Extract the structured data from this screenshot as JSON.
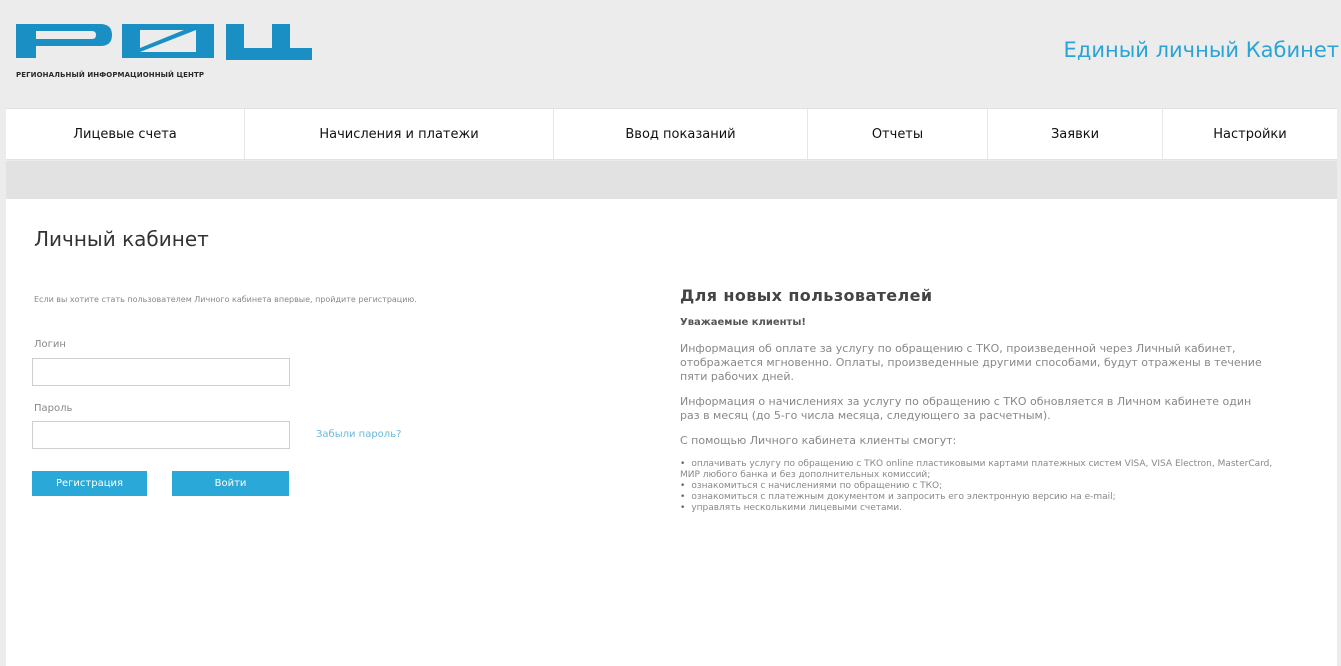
{
  "header": {
    "logo_text": "РЕГИОНАЛЬНЫЙ ИНФОРМАЦИОННЫЙ ЦЕНТР",
    "site_title": "Единый личный Кабинет",
    "brand_color": "#1a8fc4"
  },
  "nav": [
    {
      "label": "Лицевые счета"
    },
    {
      "label": "Начисления и платежи"
    },
    {
      "label": "Ввод показаний"
    },
    {
      "label": "Отчеты"
    },
    {
      "label": "Заявки"
    },
    {
      "label": "Настройки"
    }
  ],
  "login": {
    "title": "Личный кабинет",
    "registration_hint": "Если вы хотите стать пользователем Личного кабинета впервые, пройдите регистрацию.",
    "login_label": "Логин",
    "login_value": "",
    "password_label": "Пароль",
    "password_value": "",
    "forgot_link": "Забыли пароль?",
    "register_button": "Регистрация",
    "login_button": "Войти",
    "button_color": "#2aa8d8"
  },
  "info": {
    "title": "Для новых пользователей",
    "greeting": "Уважаемые клиенты!",
    "paragraphs": [
      "Информация об оплате за услугу по обращению с ТКО, произведенной через Личный кабинет, отображается мгновенно. Оплаты, произведенные другими способами, будут отражены в течение пяти рабочих дней.",
      "Информация о начислениях за услугу по обращению с ТКО обновляется в Личном кабинете один раз в месяц (до 5-го числа месяца, следующего за расчетным).",
      "С помощью Личного кабинета клиенты смогут:"
    ],
    "list": [
      "оплачивать услугу по обращению с ТКО online пластиковыми картами платежных систем VISA, VISA Electron, MasterCard, МИР любого банка и без дополнительных комиссий;",
      "ознакомиться с начислениями по обращению с ТКО;",
      "ознакомиться с платежным документом и запросить его электронную версию на e-mail;",
      "управлять несколькими лицевыми счетами."
    ]
  }
}
